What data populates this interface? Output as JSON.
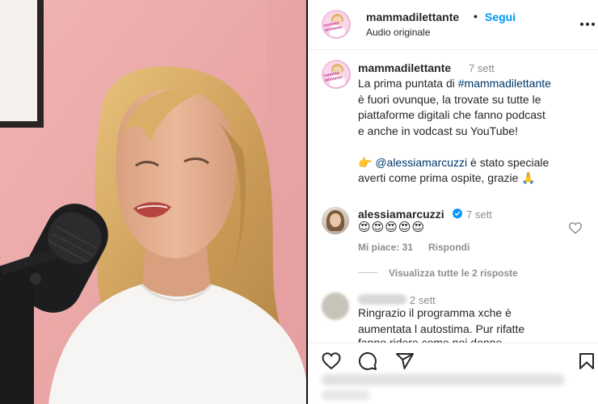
{
  "header": {
    "username": "mammadilettante",
    "separator": "•",
    "follow_label": "Segui",
    "audio_label": "Audio originale",
    "more_icon": "more-options-icon",
    "avatar_text": "mamma dilettante"
  },
  "caption": {
    "username": "mammadilettante",
    "time": "7 sett",
    "line1_prefix": "La prima puntata di ",
    "hashtag": "#mammadilettante",
    "line2": "è fuori ovunque, la trovate su tutte le",
    "line3": "piattaforme digitali che fanno podcast",
    "line4": "e anche in vodcast su YouTube!",
    "line5_emoji": "👉",
    "mention": "@alessiamarcuzzi",
    "line5_suffix": " è stato speciale",
    "line6": "averti come prima ospite, grazie 🙏"
  },
  "comment1": {
    "username": "alessiamarcuzzi",
    "time": "7 sett",
    "text": "😍😍😍😍😍",
    "likes": "Mi piace: 31",
    "reply_label": "Rispondi",
    "view_replies": "Visualizza tutte le 2 risposte"
  },
  "comment2": {
    "time": "2 sett",
    "line1": "Ringrazio il programma xche è",
    "line2": "aumentata l autostima. Pur rifatte",
    "line3": "fanno ridere come noi donne"
  },
  "actions": {
    "like_icon": "heart-icon",
    "comment_icon": "comment-icon",
    "share_icon": "share-icon",
    "save_icon": "bookmark-icon"
  },
  "colors": {
    "link_blue": "#0095f6",
    "tag_blue": "#00376b",
    "muted": "#8e8e8e",
    "wall_pink": "#e9a6a6"
  }
}
